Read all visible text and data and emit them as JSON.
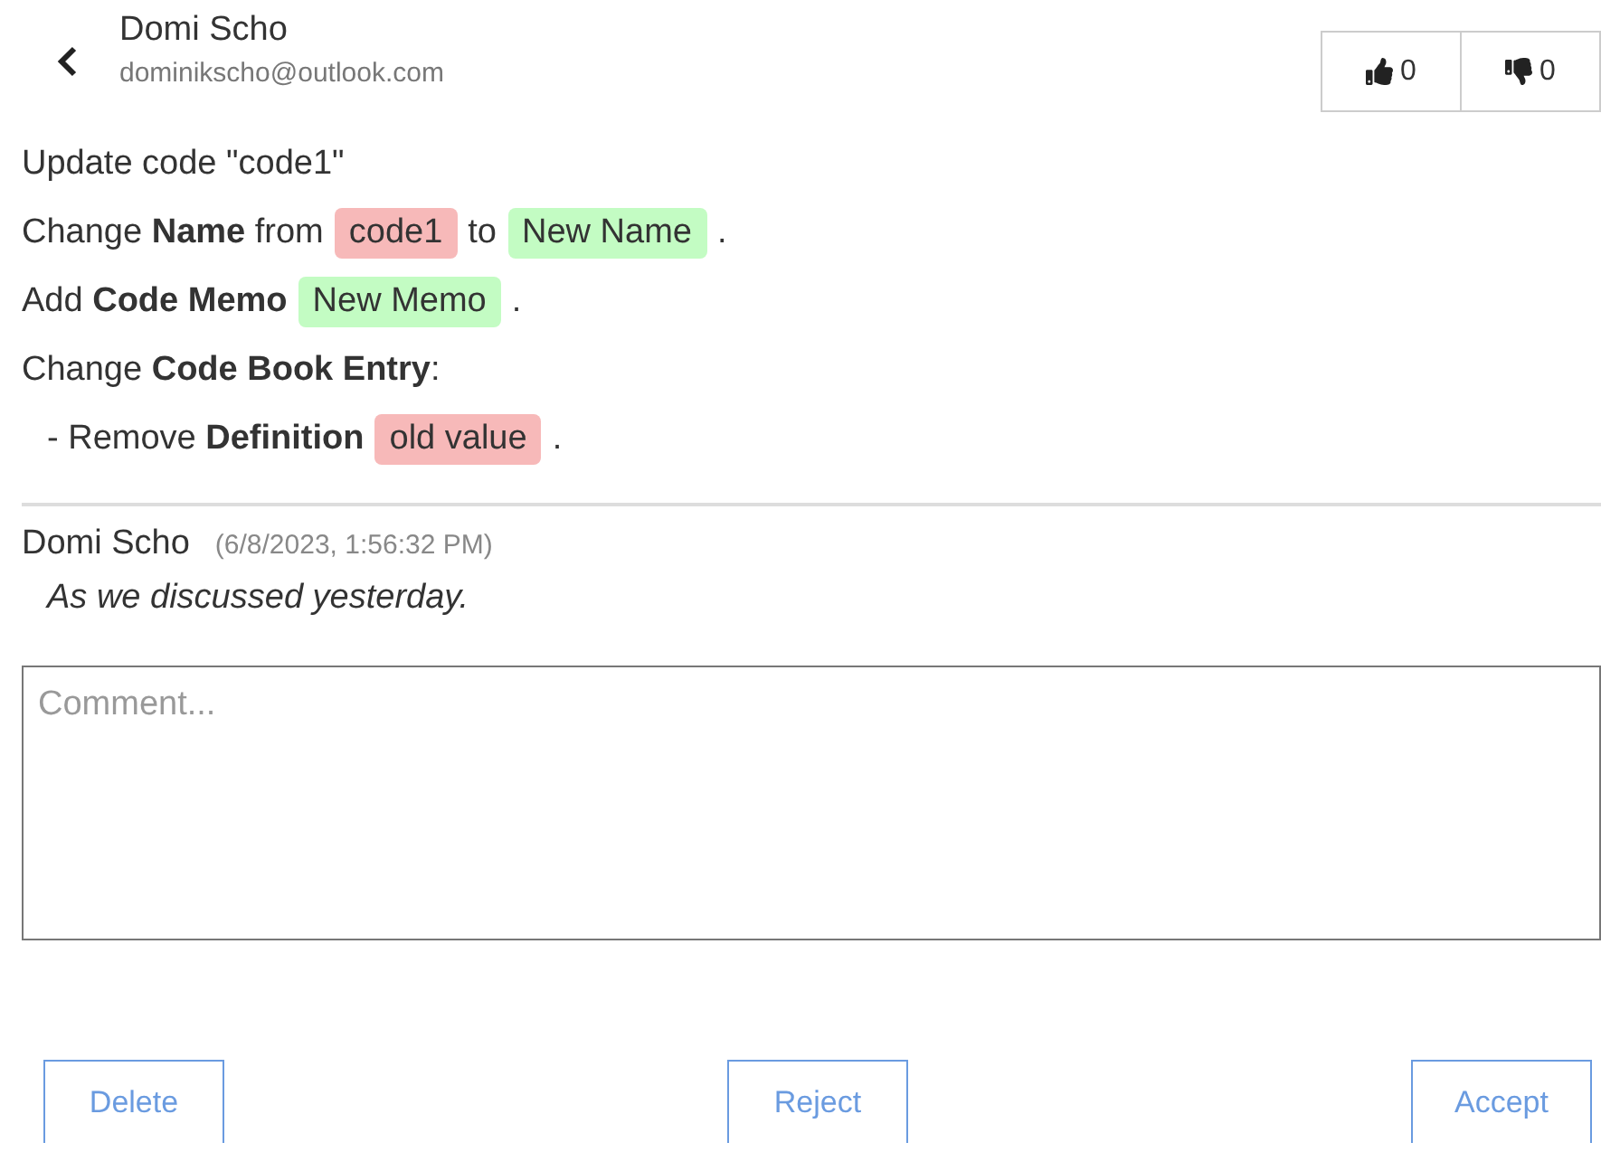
{
  "header": {
    "name": "Domi Scho",
    "email": "dominikscho@outlook.com"
  },
  "votes": [
    {
      "kind": "up",
      "count": "0"
    },
    {
      "kind": "down",
      "count": "0"
    }
  ],
  "changes": [
    {
      "indent": false,
      "parts": [
        {
          "kind": "text",
          "text": "Update code \"code1\""
        }
      ]
    },
    {
      "indent": false,
      "parts": [
        {
          "kind": "text",
          "text": "Change **Name** from"
        },
        {
          "kind": "removed",
          "text": "code1"
        },
        {
          "kind": "text",
          "text": "to"
        },
        {
          "kind": "added",
          "text": "New Name"
        },
        {
          "kind": "text",
          "text": "."
        }
      ]
    },
    {
      "indent": false,
      "parts": [
        {
          "kind": "text",
          "text": "Add **Code Memo**"
        },
        {
          "kind": "added",
          "text": "New Memo"
        },
        {
          "kind": "text",
          "text": "."
        }
      ]
    },
    {
      "indent": false,
      "parts": [
        {
          "kind": "text",
          "text": "Change **Code Book Entry**:"
        }
      ]
    },
    {
      "indent": true,
      "parts": [
        {
          "kind": "text",
          "text": "- Remove **Definition**"
        },
        {
          "kind": "removed",
          "text": "old value"
        },
        {
          "kind": "text",
          "text": "."
        }
      ]
    }
  ],
  "comments": [
    {
      "author": "Domi Scho",
      "time": "(6/8/2023, 1:56:32 PM)",
      "text": "As we discussed yesterday."
    }
  ],
  "comment_field": {
    "placeholder": "Comment..."
  },
  "actions": [
    "Delete",
    "Reject",
    "Accept"
  ]
}
